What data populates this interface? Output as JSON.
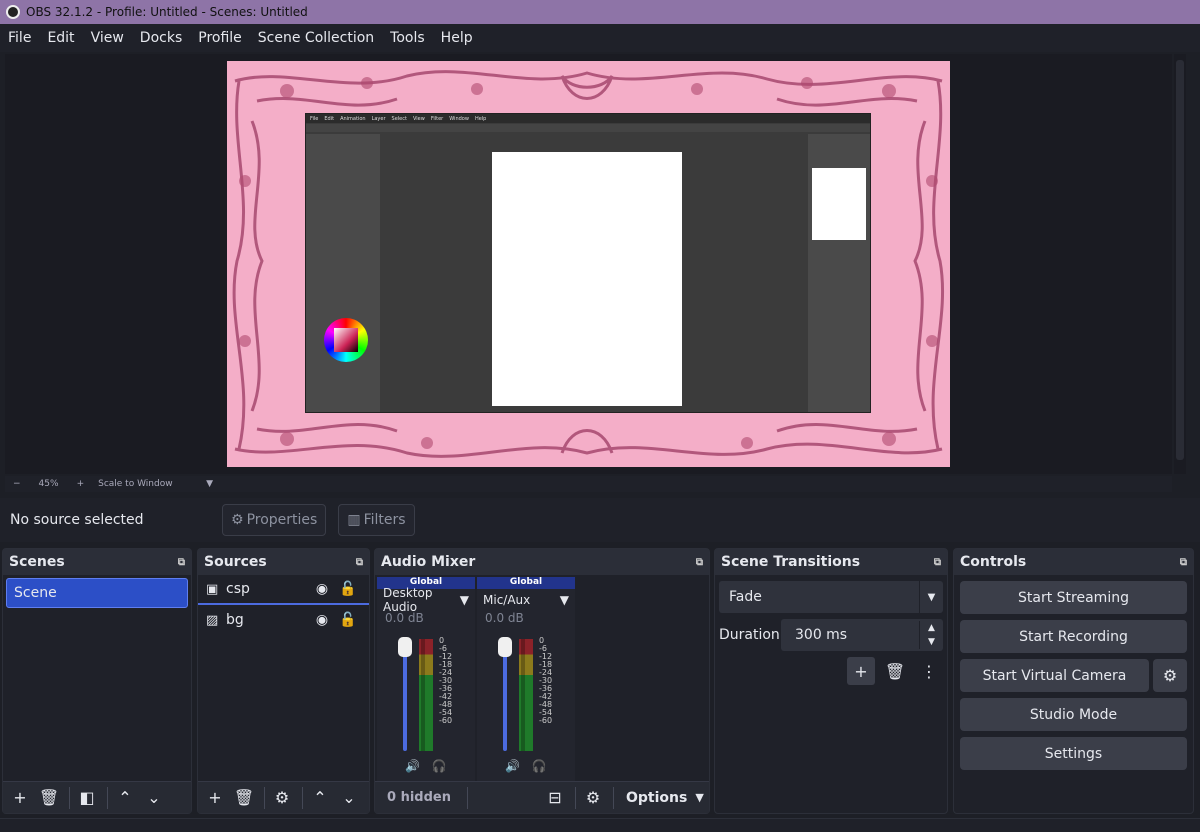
{
  "window": {
    "title": "OBS 32.1.2 - Profile: Untitled - Scenes: Untitled"
  },
  "menu": [
    "File",
    "Edit",
    "View",
    "Docks",
    "Profile",
    "Scene Collection",
    "Tools",
    "Help"
  ],
  "preview": {
    "inner_app_menu": [
      "File",
      "Edit",
      "Animation",
      "Layer",
      "Select",
      "View",
      "Filter",
      "Window",
      "Help"
    ],
    "zoom_minus": "−",
    "zoom_value": "45%",
    "zoom_plus": "+",
    "scale_mode": "Scale to Window"
  },
  "source_toolbar": {
    "no_source": "No source selected",
    "properties_label": "Properties",
    "filters_label": "Filters"
  },
  "scenes": {
    "title": "Scenes",
    "items": [
      "Scene"
    ]
  },
  "sources": {
    "title": "Sources",
    "items": [
      {
        "name": "csp",
        "icon": "window-capture-icon",
        "visible": true,
        "locked": false
      },
      {
        "name": "bg",
        "icon": "image-icon",
        "visible": true,
        "locked": false
      }
    ]
  },
  "audio_mixer": {
    "title": "Audio Mixer",
    "channels": [
      {
        "badge": "Global",
        "name": "Desktop Audio",
        "level": "0.0 dB"
      },
      {
        "badge": "Global",
        "name": "Mic/Aux",
        "level": "0.0 dB"
      }
    ],
    "scale": [
      "0",
      "-6",
      "-12",
      "-18",
      "-24",
      "-30",
      "-36",
      "-42",
      "-48",
      "-54",
      "-60"
    ],
    "hidden_label": "0 hidden",
    "options_label": "Options"
  },
  "scene_transitions": {
    "title": "Scene Transitions",
    "transition": "Fade",
    "duration_label": "Duration",
    "duration_value": "300 ms"
  },
  "controls": {
    "title": "Controls",
    "start_streaming": "Start Streaming",
    "start_recording": "Start Recording",
    "start_virtual_camera": "Start Virtual Camera",
    "studio_mode": "Studio Mode",
    "settings": "Settings"
  },
  "colors": {
    "titlebar": "#8e74a7",
    "accent": "#2c4fc7",
    "canvas_bg": "#f4aec8",
    "frame_ink": "#9c3b63"
  }
}
